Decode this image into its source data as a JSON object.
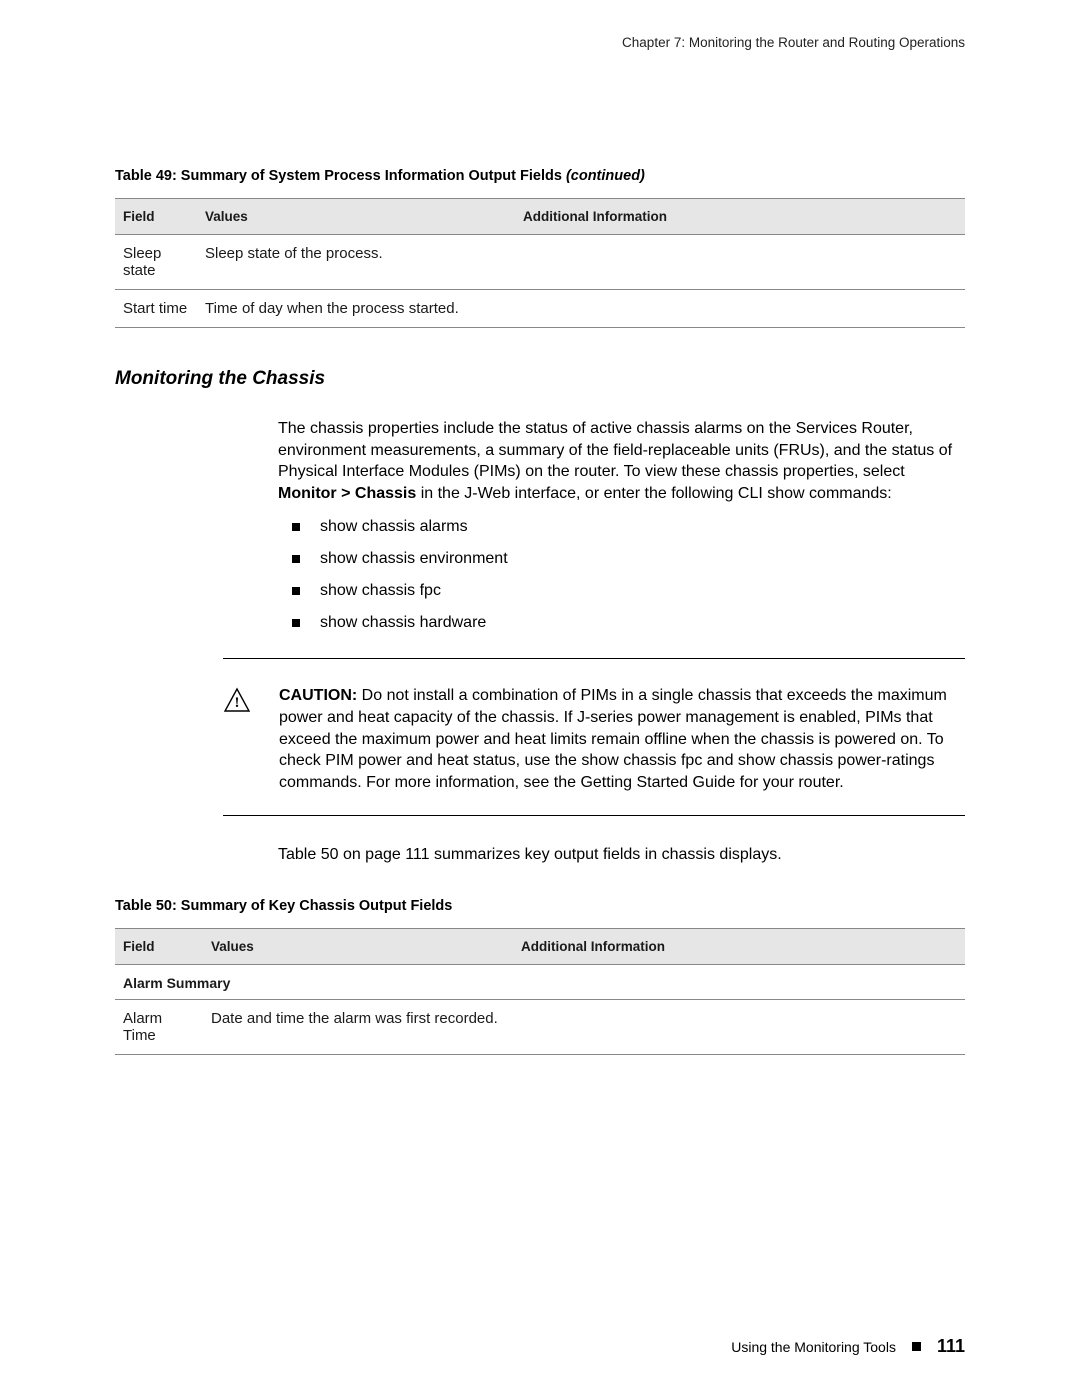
{
  "chapter_header": "Chapter 7: Monitoring the Router and Routing Operations",
  "table49": {
    "caption_main": "Table 49: Summary of System Process Information Output Fields ",
    "caption_cont": "(continued)",
    "head": {
      "c1": "Field",
      "c2": "Values",
      "c3": "Additional Information"
    },
    "rows": [
      {
        "field": "Sleep state",
        "values": "Sleep state of the process.",
        "info": ""
      },
      {
        "field": "Start time",
        "values": "Time of day when the process started.",
        "info": ""
      }
    ]
  },
  "section_heading": "Monitoring the Chassis",
  "intro_para_parts": {
    "p1a": "The chassis properties include the status of active chassis alarms on the Services Router, environment measurements, a summary of the field-replaceable units (FRUs), and the status of Physical Interface Modules (PIMs) on the router. To view these chassis properties, select ",
    "p1b": "Monitor > Chassis",
    "p1c": " in the J-Web interface, or enter the following CLI ",
    "p1d": "show",
    "p1e": " commands:"
  },
  "commands": [
    "show chassis alarms",
    "show chassis environment",
    "show chassis fpc",
    "show chassis hardware"
  ],
  "caution": {
    "label": "CAUTION:",
    "t1": " Do not install a combination of PIMs in a single chassis that exceeds the maximum power and heat capacity of the chassis. If J-series power management is enabled, PIMs that exceed the maximum power and heat limits remain offline when the chassis is powered on. To check PIM power and heat status, use the ",
    "cmd1": "show chassis fpc",
    "t2": " and ",
    "cmd2": "show chassis power-ratings",
    "t3": " commands. For more information, see the Getting Started Guide for your router."
  },
  "post_caution_para": "Table 50 on page 111 summarizes key output fields in chassis displays.",
  "table50": {
    "caption": "Table 50: Summary of Key Chassis Output Fields",
    "head": {
      "c1": "Field",
      "c2": "Values",
      "c3": "Additional Information"
    },
    "section_label": "Alarm Summary",
    "rows": [
      {
        "field": "Alarm Time",
        "values": "Date and time the alarm was first recorded.",
        "info": ""
      }
    ]
  },
  "footer": {
    "text": "Using the Monitoring Tools",
    "page": "111"
  }
}
